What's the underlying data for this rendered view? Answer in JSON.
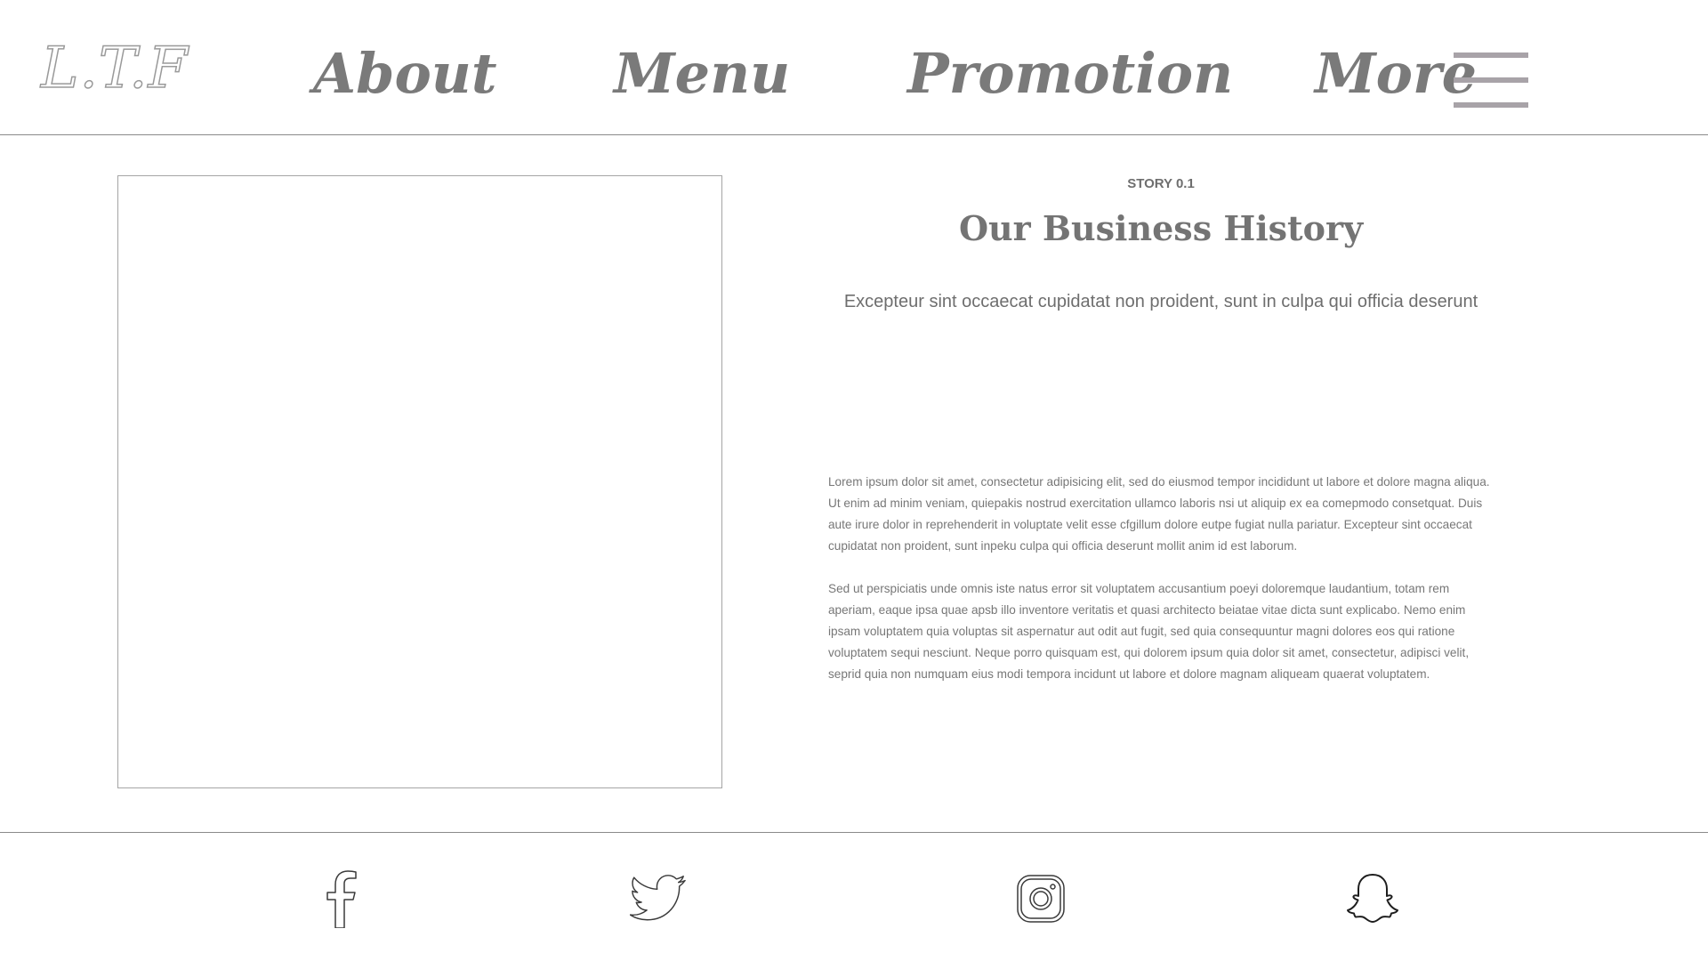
{
  "header": {
    "logo": "L.T.F",
    "nav": {
      "about": "About",
      "menu": "Menu",
      "promotion": "Promotion",
      "more": "More"
    }
  },
  "story": {
    "label": "STORY 0.1",
    "title": "Our Business History",
    "subtitle": "Excepteur sint occaecat cupidatat non proident, sunt in culpa qui officia deserunt",
    "paragraphs": [
      "Lorem ipsum dolor sit amet, consectetur adipisicing elit, sed do eiusmod tempor incididunt ut labore et dolore magna aliqua. Ut enim ad minim veniam, quiepakis nostrud exercitation ullamco laboris nsi ut aliquip ex ea comepmodo consetquat. Duis aute irure dolor in reprehenderit in voluptate velit esse cfgillum dolore eutpe fugiat nulla pariatur. Excepteur sint occaecat cupidatat non proident, sunt inpeku culpa qui officia deserunt mollit anim id est laborum.",
      "Sed ut perspiciatis unde omnis iste natus error sit voluptatem accusantium poeyi doloremque laudantium, totam rem aperiam, eaque ipsa quae apsb illo inventore veritatis et quasi architecto beiatae vitae dicta sunt explicabo. Nemo enim ipsam voluptatem quia voluptas sit aspernatur aut odit aut fugit, sed quia consequuntur magni dolores eos qui ratione voluptatem sequi nesciunt. Neque porro quisquam est, qui dolorem ipsum quia dolor sit amet, consectetur, adipisci velit, seprid quia non numquam eius modi tempora incidunt ut labore et dolore magnam aliqueam quaerat voluptatem."
    ]
  },
  "footer": {
    "social_icons": [
      "facebook-icon",
      "twitter-icon",
      "instagram-icon",
      "snapchat-icon"
    ]
  },
  "colors": {
    "nav_text": "#7a7a7a",
    "hamburger": "#a8a3a8",
    "body_text": "#777777",
    "divider": "#8a8a8a"
  }
}
